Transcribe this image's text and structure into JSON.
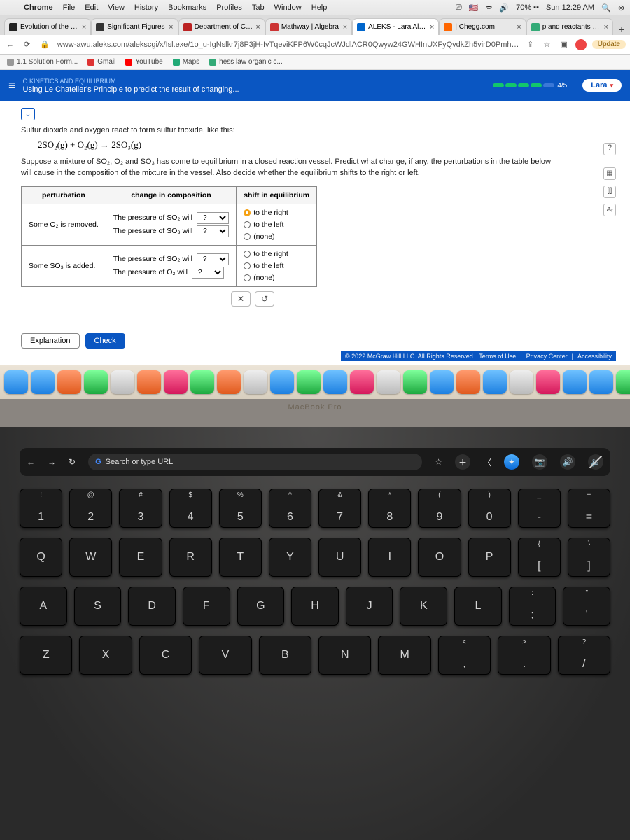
{
  "menubar": {
    "app": "Chrome",
    "items": [
      "File",
      "Edit",
      "View",
      "History",
      "Bookmarks",
      "Profiles",
      "Tab",
      "Window",
      "Help"
    ],
    "right": {
      "battery": "70%",
      "time": "Sun 12:29 AM"
    }
  },
  "tabs": [
    {
      "label": "Evolution of the Ga",
      "fav": "#222"
    },
    {
      "label": "Significant Figures",
      "fav": "#333"
    },
    {
      "label": "Department of Che",
      "fav": "#b22"
    },
    {
      "label": "Mathway | Algebra",
      "fav": "#c33"
    },
    {
      "label": "ALEKS - Lara Altha",
      "fav": "#06c",
      "active": true
    },
    {
      "label": "| Chegg.com",
      "fav": "#f60"
    },
    {
      "label": "p and reactants - G",
      "fav": "#3a7"
    }
  ],
  "omnibar": {
    "url": "www-awu.aleks.com/alekscgi/x/Isl.exe/1o_u-IgNslkr7j8P3jH-IvTqeviKFP6W0cqJcWJdlACR0Qwyw24GWHInUXFyQvdkZh5virD0Pmh_cH_ATXzhtsC-0afVp3NS_...",
    "update": "Update"
  },
  "bookmarks": [
    {
      "label": "1.1 Solution Form...",
      "color": "#999"
    },
    {
      "label": "Gmail",
      "color": "#d33"
    },
    {
      "label": "YouTube",
      "color": "#f00"
    },
    {
      "label": "Maps",
      "color": "#2a7"
    },
    {
      "label": "hess law organic c...",
      "color": "#3a7"
    }
  ],
  "aleks": {
    "kicker": "O KINETICS AND EQUILIBRIUM",
    "title": "Using Le Chatelier's Principle to predict the result of changing...",
    "progress": "4/5",
    "user": "Lara"
  },
  "problem": {
    "intro": "Sulfur dioxide and oxygen react to form sulfur trioxide, like this:",
    "equation": "2SO₂(g) + O₂(g) → 2SO₃(g)",
    "prompt": "Suppose a mixture of SO₂, O₂ and SO₃ has come to equilibrium in a closed reaction vessel. Predict what change, if any, the perturbations in the table below will cause in the composition of the mixture in the vessel. Also decide whether the equilibrium shifts to the right or left."
  },
  "table": {
    "headers": [
      "perturbation",
      "change in composition",
      "shift in equilibrium"
    ],
    "rows": [
      {
        "pert": "Some O₂ is removed.",
        "lines": [
          {
            "label": "The pressure of SO₂ will",
            "value": "?"
          },
          {
            "label": "The pressure of SO₃ will",
            "value": "?"
          }
        ],
        "shift": {
          "opts": [
            "to the right",
            "to the left",
            "(none)"
          ],
          "selected": 0
        }
      },
      {
        "pert": "Some SO₃ is added.",
        "lines": [
          {
            "label": "The pressure of SO₂ will",
            "value": "?"
          },
          {
            "label": "The pressure of O₂ will",
            "value": "?"
          }
        ],
        "shift": {
          "opts": [
            "to the right",
            "to the left",
            "(none)"
          ],
          "selected": -1
        }
      }
    ]
  },
  "tools": {
    "close": "✕",
    "reset": "↺"
  },
  "buttons": {
    "explain": "Explanation",
    "check": "Check"
  },
  "footer": {
    "copyright": "© 2022 McGraw Hill LLC. All Rights Reserved.",
    "links": [
      "Terms of Use",
      "Privacy Center",
      "Accessibility"
    ]
  },
  "macbook": "MacBook Pro",
  "touchbar": {
    "search_placeholder": "Search or type URL"
  },
  "keys": {
    "row1": [
      {
        "u": "!",
        "l": "1"
      },
      {
        "u": "@",
        "l": "2"
      },
      {
        "u": "#",
        "l": "3"
      },
      {
        "u": "$",
        "l": "4"
      },
      {
        "u": "%",
        "l": "5"
      },
      {
        "u": "^",
        "l": "6"
      },
      {
        "u": "&",
        "l": "7"
      },
      {
        "u": "*",
        "l": "8"
      },
      {
        "u": "(",
        "l": "9"
      },
      {
        "u": ")",
        "l": "0"
      },
      {
        "u": "_",
        "l": "-"
      },
      {
        "u": "+",
        "l": "="
      }
    ],
    "row2": [
      "Q",
      "W",
      "E",
      "R",
      "T",
      "Y",
      "U",
      "I",
      "O",
      "P"
    ],
    "row2_extra": [
      {
        "u": "{",
        "l": "["
      },
      {
        "u": "}",
        "l": "]"
      }
    ],
    "row3": [
      "A",
      "S",
      "D",
      "F",
      "G",
      "H",
      "J",
      "K",
      "L"
    ],
    "row3_extra": [
      {
        "u": ":",
        "l": ";"
      },
      {
        "u": "\"",
        "l": "'"
      }
    ],
    "row4": [
      "Z",
      "X",
      "C",
      "V",
      "B",
      "N",
      "M"
    ],
    "row4_extra": [
      {
        "u": "<",
        "l": ","
      },
      {
        "u": ">",
        "l": "."
      },
      {
        "u": "?",
        "l": "/"
      }
    ]
  }
}
